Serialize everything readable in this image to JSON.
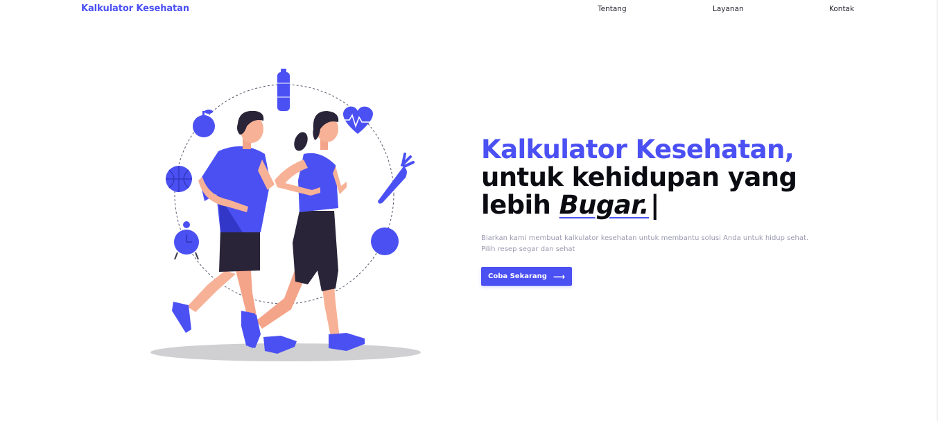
{
  "nav": {
    "brand": "Kalkulator Kesehatan",
    "links": [
      {
        "label": "Tentang"
      },
      {
        "label": "Layanan"
      },
      {
        "label": "Kontak"
      }
    ]
  },
  "hero": {
    "title_accent": "Kalkulator Kesehatan,",
    "title_line2": "untuk kehidupan yang",
    "title_line3_prefix": "lebih ",
    "title_emphasis": "Bugar.",
    "title_cursor": "|",
    "description": "Biarkan kami membuat kalkulator kesehatan untuk membantu solusi Anda untuk hidup sehat. Pilih resep segar dan sehat",
    "cta_label": "Coba Sekarang",
    "cta_icon": "arrow-right-icon"
  },
  "illustration": {
    "subject": "two-people-jogging",
    "icons": [
      "apple-icon",
      "water-bottle-icon",
      "heart-rate-icon",
      "carrot-icon",
      "basketball-icon",
      "alarm-clock-icon",
      "ball-icon"
    ]
  },
  "colors": {
    "accent": "#4b50f3",
    "text_dark": "#0b0b12",
    "text_muted": "#9a9ab0",
    "skin": "#f7b196",
    "shadow": "#d0d0d3"
  }
}
